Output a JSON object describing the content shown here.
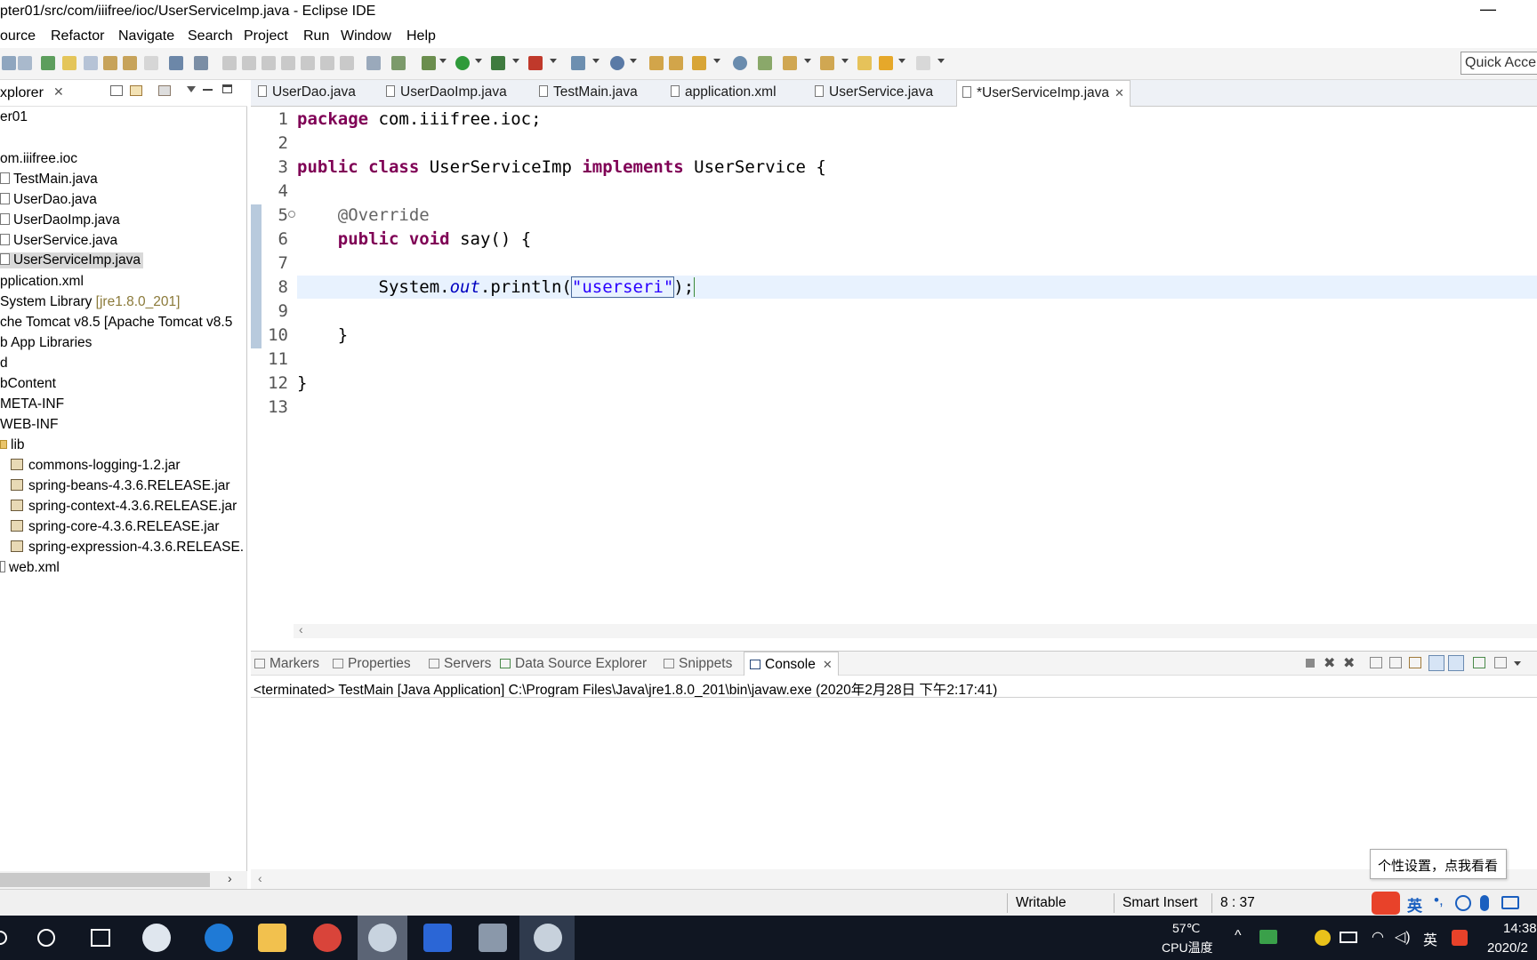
{
  "window": {
    "title": "pter01/src/com/iiifree/ioc/UserServiceImp.java - Eclipse IDE",
    "minimize_glyph": "—"
  },
  "menu": [
    "ource",
    "Refactor",
    "Navigate",
    "Search",
    "Project",
    "Run",
    "Window",
    "Help"
  ],
  "toolbar": {
    "quick_access_placeholder": "Quick Acce"
  },
  "explorer": {
    "title": "xplorer",
    "items": [
      "er01",
      "om.iiifree.ioc",
      "TestMain.java",
      "UserDao.java",
      "UserDaoImp.java",
      "UserService.java",
      "UserServiceImp.java",
      "pplication.xml",
      "System Library ",
      "[jre1.8.0_201]",
      "che Tomcat v8.5 [Apache Tomcat v8.5",
      "b App Libraries",
      "d",
      "bContent",
      "META-INF",
      "WEB-INF",
      "lib",
      "commons-logging-1.2.jar",
      "spring-beans-4.3.6.RELEASE.jar",
      "spring-context-4.3.6.RELEASE.jar",
      "spring-core-4.3.6.RELEASE.jar",
      "spring-expression-4.3.6.RELEASE.",
      "web.xml"
    ]
  },
  "editor": {
    "tabs": [
      "UserDao.java",
      "UserDaoImp.java",
      "TestMain.java",
      "application.xml",
      "UserService.java",
      "*UserServiceImp.java"
    ],
    "active_tab_index": 5,
    "line_numbers": [
      "1",
      "2",
      "3",
      "4",
      "5",
      "6",
      "7",
      "8",
      "9",
      "10",
      "11",
      "12",
      "13"
    ],
    "code": {
      "l1_kw": "package",
      "l1_rest": " com.iiifree.ioc;",
      "l3_kw1": "public",
      "l3_kw2": "class",
      "l3_name": " UserServiceImp ",
      "l3_kw3": "implements",
      "l3_rest": " UserService {",
      "l5_ann": "    @Override",
      "l6_indent": "    ",
      "l6_kw1": "public",
      "l6_kw2": "void",
      "l6_rest": " say() {",
      "l8_a": "        System.",
      "l8_field": "out",
      "l8_b": ".println(",
      "l8_str": "\"userseri\"",
      "l8_c": ");",
      "l10": "    }",
      "l12": "}"
    }
  },
  "console": {
    "tabs": [
      "Markers",
      "Properties",
      "Servers",
      "Data Source Explorer",
      "Snippets",
      "Console"
    ],
    "active_tab_index": 5,
    "output": "<terminated> TestMain [Java Application] C:\\Program Files\\Java\\jre1.8.0_201\\bin\\javaw.exe (2020年2月28日 下午2:17:41)"
  },
  "statusbar": {
    "writable": "Writable",
    "insert_mode": "Smart Insert",
    "position": "8 : 37"
  },
  "ime_tooltip": "个性设置，点我看看",
  "taskbar": {
    "temperature": "57℃",
    "temperature_label": "CPU温度",
    "ime_lang": "英",
    "clock_time": "14:38",
    "clock_date": "2020/2"
  },
  "colors": {
    "keyword": "#7f0055",
    "string": "#2a00ff",
    "annotation": "#646464",
    "field": "#0000c0",
    "current_line": "#e8f2fe",
    "taskbar": "#101622"
  }
}
